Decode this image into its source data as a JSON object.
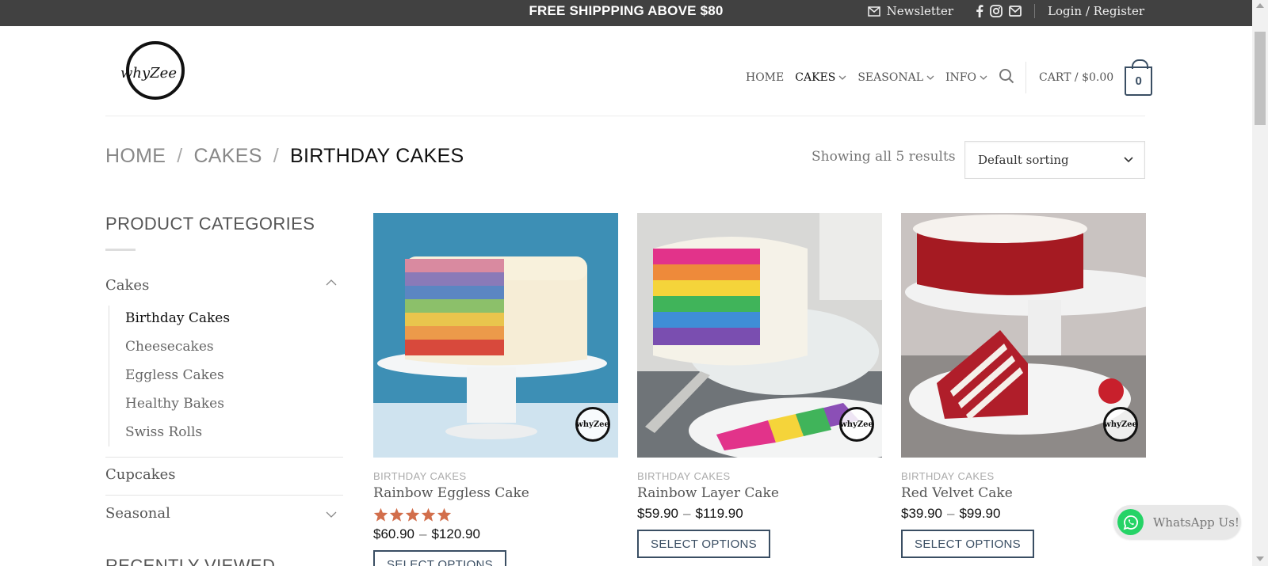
{
  "topbar": {
    "promo": "FREE SHIPPPING ABOVE $80",
    "newsletter": "Newsletter",
    "social_icons": [
      "facebook-icon",
      "instagram-icon",
      "email-icon"
    ],
    "login": "Login / Register"
  },
  "header": {
    "logo_text": "whyZee",
    "nav": [
      {
        "label": "HOME",
        "has_dropdown": false,
        "active": false
      },
      {
        "label": "CAKES",
        "has_dropdown": true,
        "active": true
      },
      {
        "label": "SEASONAL",
        "has_dropdown": true,
        "active": false
      },
      {
        "label": "INFO",
        "has_dropdown": true,
        "active": false
      }
    ],
    "cart_label": "CART /",
    "cart_total": "$0.00",
    "cart_count": "0"
  },
  "breadcrumb": {
    "items": [
      "HOME",
      "CAKES",
      "BIRTHDAY CAKES"
    ]
  },
  "results_text": "Showing all 5 results",
  "sorting": {
    "selected": "Default sorting"
  },
  "sidebar": {
    "title": "PRODUCT CATEGORIES",
    "categories": [
      {
        "label": "Cakes",
        "expanded": true,
        "subcategories": [
          "Birthday Cakes",
          "Cheesecakes",
          "Eggless Cakes",
          "Healthy Bakes",
          "Swiss Rolls"
        ],
        "active_sub": "Birthday Cakes"
      },
      {
        "label": "Cupcakes",
        "expanded": false
      },
      {
        "label": "Seasonal",
        "expanded": false
      }
    ],
    "recently_viewed": "RECENTLY VIEWED"
  },
  "products": [
    {
      "category": "BIRTHDAY CAKES",
      "name": "Rainbow Eggless Cake",
      "price_min": "$60.90",
      "price_max": "$120.90",
      "rating": 5,
      "button": "SELECT OPTIONS"
    },
    {
      "category": "BIRTHDAY CAKES",
      "name": "Rainbow Layer Cake",
      "price_min": "$59.90",
      "price_max": "$119.90",
      "button": "SELECT OPTIONS"
    },
    {
      "category": "BIRTHDAY CAKES",
      "name": "Red Velvet Cake",
      "price_min": "$39.90",
      "price_max": "$99.90",
      "button": "SELECT OPTIONS"
    }
  ],
  "whatsapp": {
    "label": "WhatsApp Us!"
  },
  "colors": {
    "topbar": "#414141",
    "accent": "#3a4e63",
    "star": "#d26e4b",
    "whatsapp": "#25d366"
  }
}
